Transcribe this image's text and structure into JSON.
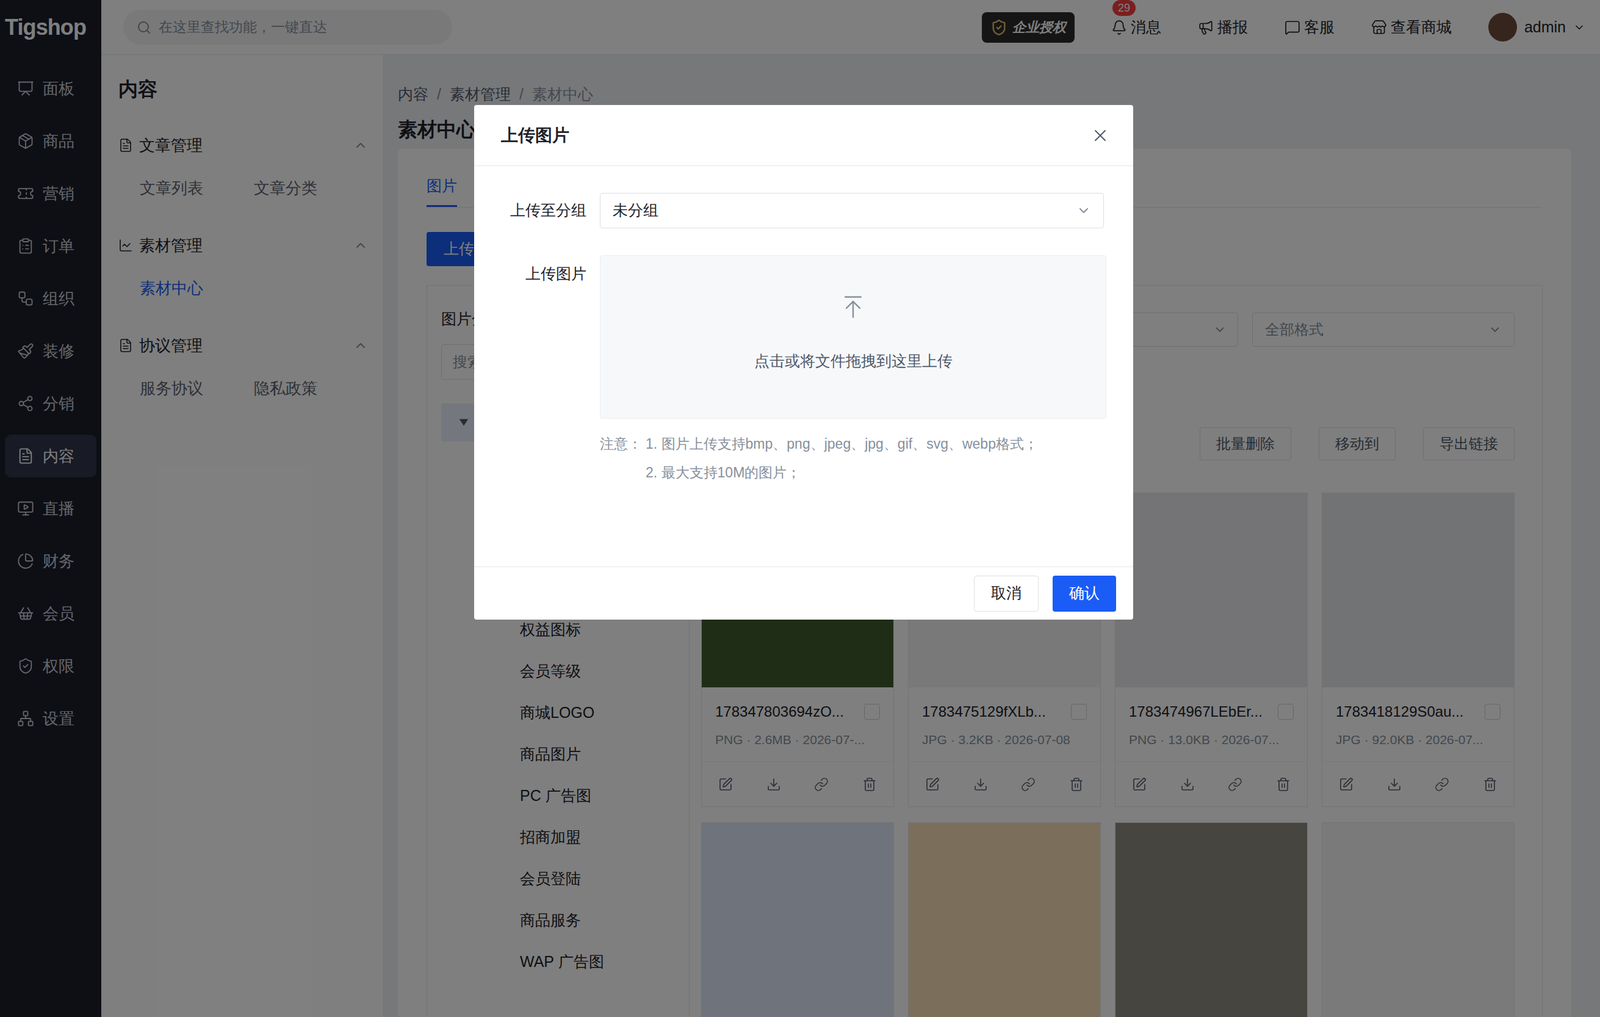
{
  "window": {
    "title": "素材中心"
  },
  "sidebar": {
    "logo": "Tigshop",
    "items": [
      {
        "label": "面板",
        "selected": false
      },
      {
        "label": "商品",
        "selected": false
      },
      {
        "label": "营销",
        "selected": false
      },
      {
        "label": "订单",
        "selected": false
      },
      {
        "label": "组织",
        "selected": false
      },
      {
        "label": "装修",
        "selected": false
      },
      {
        "label": "分销",
        "selected": false
      },
      {
        "label": "内容",
        "selected": true
      },
      {
        "label": "直播",
        "selected": false
      },
      {
        "label": "财务",
        "selected": false
      },
      {
        "label": "会员",
        "selected": false
      },
      {
        "label": "权限",
        "selected": false
      },
      {
        "label": "设置",
        "selected": false
      }
    ]
  },
  "topbar": {
    "search_placeholder": "在这里查找功能，一键直达",
    "license": "企业授权",
    "items": [
      {
        "label": "消息",
        "badge": "29"
      },
      {
        "label": "播报",
        "badge": null
      },
      {
        "label": "客服",
        "badge": null
      },
      {
        "label": "查看商城",
        "badge": null
      }
    ],
    "user": "admin"
  },
  "subnav": {
    "title": "内容",
    "groups": [
      {
        "label": "文章管理",
        "expanded": true,
        "items": [
          {
            "label": "文章列表",
            "selected": false
          },
          {
            "label": "文章分类",
            "selected": false
          }
        ]
      },
      {
        "label": "素材管理",
        "expanded": true,
        "items": [
          {
            "label": "素材中心",
            "selected": true
          }
        ]
      },
      {
        "label": "协议管理",
        "expanded": true,
        "items": [
          {
            "label": "服务协议",
            "selected": false
          },
          {
            "label": "隐私政策",
            "selected": false
          }
        ]
      }
    ]
  },
  "breadcrumb": {
    "separator": "/",
    "items": [
      "内容",
      "素材管理",
      "素材中心"
    ]
  },
  "page_title": "素材中心",
  "tabs": [
    {
      "label": "图片",
      "selected": true
    }
  ],
  "upload_button": "上传",
  "groups_panel": {
    "title": "图片分",
    "search_placeholder": "搜索",
    "root_expanded": true,
    "items": [
      "权益图标",
      "会员等级",
      "商城LOGO",
      "商品图片",
      "PC 广告图",
      "招商加盟",
      "会员登陆",
      "商品服务",
      "WAP 广告图"
    ]
  },
  "format_filter": "全部格式",
  "toolbar": [
    "批量删除",
    "移动到",
    "导出链接"
  ],
  "images": [
    {
      "name": "178347803694zO...",
      "meta": "PNG · 2.6MB · 2026-07-...",
      "checked": false,
      "color": "#3f5a2c"
    },
    {
      "name": "1783475129fXLb...",
      "meta": "JPG · 3.2KB · 2026-07-08",
      "checked": false,
      "color": "#f2f2f2"
    },
    {
      "name": "1783474967LEbEr...",
      "meta": "PNG · 13.0KB · 2026-07...",
      "checked": false,
      "color": "#e9e9ec"
    },
    {
      "name": "1783418129S0au...",
      "meta": "JPG · 92.0KB · 2026-07...",
      "checked": false,
      "color": "#e4e6ea"
    }
  ],
  "more_images": [
    {
      "color": "#dfe9f8"
    },
    {
      "color": "#f6dfb8"
    },
    {
      "color": "#8e8a80"
    },
    {
      "color": "#f4f4f6"
    }
  ],
  "dialog": {
    "title": "上传图片",
    "group_label": "上传至分组",
    "group_value": "未分组",
    "upload_label": "上传图片",
    "dropzone_text": "点击或将文件拖拽到这里上传",
    "notes_label": "注意：",
    "notes": [
      "1. 图片上传支持bmp、png、jpeg、jpg、gif、svg、webp格式；",
      "2. 最大支持10M的图片；"
    ],
    "buttons": [
      {
        "label": "取消",
        "kind": "default"
      },
      {
        "label": "确认",
        "kind": "primary"
      }
    ]
  }
}
